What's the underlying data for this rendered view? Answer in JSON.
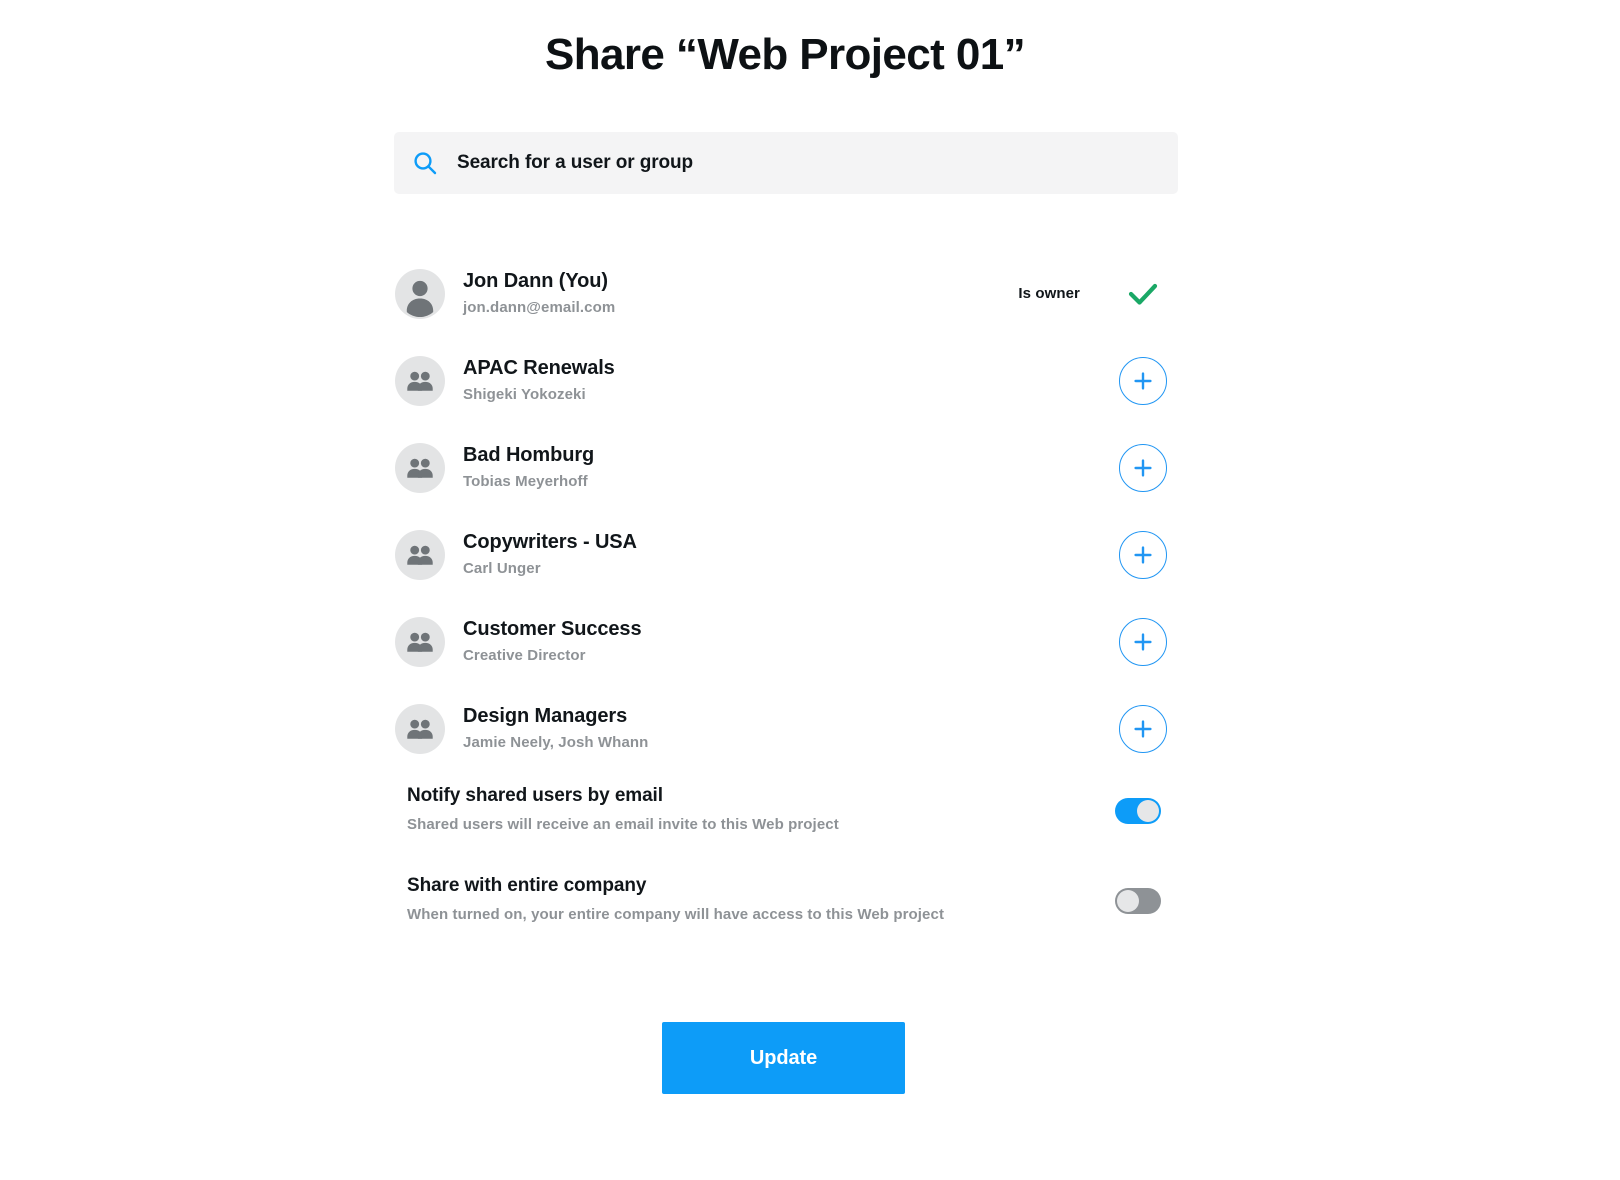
{
  "dialog": {
    "title": "Share “Web Project 01”"
  },
  "search": {
    "icon": "search-icon",
    "placeholder": "Search for a user or group",
    "value": ""
  },
  "people": [
    {
      "name": "Jon Dann (You)",
      "detail": "jon.dann@email.com",
      "avatar": "person-icon",
      "status_label": "Is owner",
      "action": "owner-check",
      "type": "user"
    },
    {
      "name": "APAC Renewals",
      "detail": "Shigeki Yokozeki",
      "avatar": "group-icon",
      "status_label": "",
      "action": "add",
      "type": "group"
    },
    {
      "name": "Bad Homburg",
      "detail": "Tobias Meyerhoff",
      "avatar": "group-icon",
      "status_label": "",
      "action": "add",
      "type": "group"
    },
    {
      "name": "Copywriters - USA",
      "detail": "Carl Unger",
      "avatar": "group-icon",
      "status_label": "",
      "action": "add",
      "type": "group"
    },
    {
      "name": "Customer Success",
      "detail": "Creative Director",
      "avatar": "group-icon",
      "status_label": "",
      "action": "add",
      "type": "group"
    },
    {
      "name": "Design Managers",
      "detail": "Jamie Neely, Josh Whann",
      "avatar": "group-icon",
      "status_label": "",
      "action": "add",
      "type": "group"
    }
  ],
  "settings": [
    {
      "title": "Notify shared users by email",
      "description": "Shared users will receive an email invite to this Web project",
      "state": "on"
    },
    {
      "title": "Share with entire company",
      "description": "When turned on, your entire company will have access to this Web project",
      "state": "off"
    }
  ],
  "footer": {
    "update_label": "Update"
  },
  "colors": {
    "accent_blue": "#0d9cf8",
    "outline_blue": "#2196f3",
    "owner_green": "#1aa866",
    "toggle_off_gray": "#8e9296",
    "field_gray": "#f4f4f5",
    "muted_text": "#8e9296"
  }
}
